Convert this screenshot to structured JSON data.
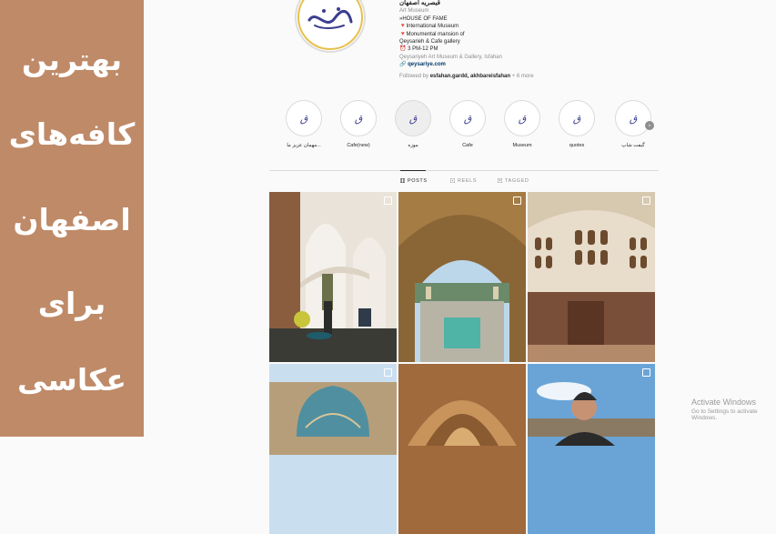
{
  "banner": {
    "lines": [
      "بهترین",
      "کافه‌های",
      "اصفهان",
      "برای",
      "عکاسی"
    ]
  },
  "profile": {
    "name": "قیصریه اصفهان",
    "category": "Art Museum",
    "bio_lines": [
      "»HOUSE OF FAME",
      "🔻International Museum",
      "🔻Monumental mansion of",
      "Qeysarieh & Cafe gallery",
      "⏰ 3 PM-12 PM"
    ],
    "location": "Qeysariyeh Art Museum & Gallery, Isfahan",
    "link": "qeysariye.com",
    "followed_prefix": "Followed by",
    "followed_names": "esfahan.gardd, akhbareisfahan",
    "followed_more": "+ 6 more"
  },
  "highlights": [
    {
      "label": "مهمان عزیز ما..."
    },
    {
      "label": "Cafe(new)"
    },
    {
      "label": "موزه"
    },
    {
      "label": "Cafe"
    },
    {
      "label": "Museum"
    },
    {
      "label": "quotes"
    },
    {
      "label": "گیفت شاپ"
    }
  ],
  "tabs": {
    "posts": "POSTS",
    "reels": "REELS",
    "tagged": "TAGGED"
  },
  "watermark": {
    "title": "Activate Windows",
    "subtitle": "Go to Settings to activate Windows."
  },
  "colors": {
    "banner": "#bf8a68",
    "page_bg": "#fafafa"
  }
}
